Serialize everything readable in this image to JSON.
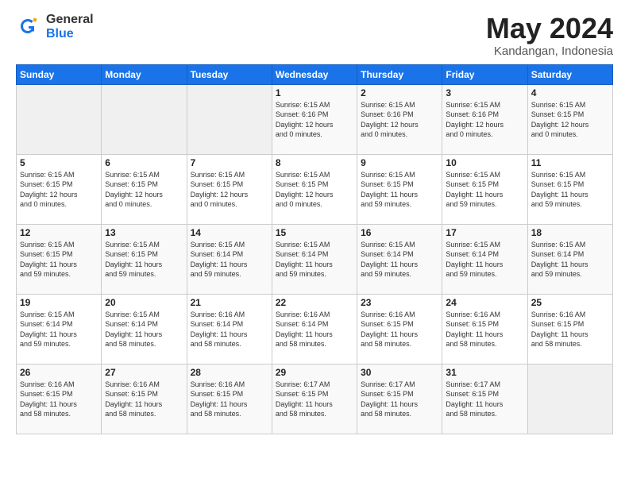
{
  "header": {
    "logo_general": "General",
    "logo_blue": "Blue",
    "title": "May 2024",
    "location": "Kandangan, Indonesia"
  },
  "weekdays": [
    "Sunday",
    "Monday",
    "Tuesday",
    "Wednesday",
    "Thursday",
    "Friday",
    "Saturday"
  ],
  "weeks": [
    [
      {
        "day": "",
        "info": ""
      },
      {
        "day": "",
        "info": ""
      },
      {
        "day": "",
        "info": ""
      },
      {
        "day": "1",
        "info": "Sunrise: 6:15 AM\nSunset: 6:16 PM\nDaylight: 12 hours\nand 0 minutes."
      },
      {
        "day": "2",
        "info": "Sunrise: 6:15 AM\nSunset: 6:16 PM\nDaylight: 12 hours\nand 0 minutes."
      },
      {
        "day": "3",
        "info": "Sunrise: 6:15 AM\nSunset: 6:16 PM\nDaylight: 12 hours\nand 0 minutes."
      },
      {
        "day": "4",
        "info": "Sunrise: 6:15 AM\nSunset: 6:15 PM\nDaylight: 12 hours\nand 0 minutes."
      }
    ],
    [
      {
        "day": "5",
        "info": "Sunrise: 6:15 AM\nSunset: 6:15 PM\nDaylight: 12 hours\nand 0 minutes."
      },
      {
        "day": "6",
        "info": "Sunrise: 6:15 AM\nSunset: 6:15 PM\nDaylight: 12 hours\nand 0 minutes."
      },
      {
        "day": "7",
        "info": "Sunrise: 6:15 AM\nSunset: 6:15 PM\nDaylight: 12 hours\nand 0 minutes."
      },
      {
        "day": "8",
        "info": "Sunrise: 6:15 AM\nSunset: 6:15 PM\nDaylight: 12 hours\nand 0 minutes."
      },
      {
        "day": "9",
        "info": "Sunrise: 6:15 AM\nSunset: 6:15 PM\nDaylight: 11 hours\nand 59 minutes."
      },
      {
        "day": "10",
        "info": "Sunrise: 6:15 AM\nSunset: 6:15 PM\nDaylight: 11 hours\nand 59 minutes."
      },
      {
        "day": "11",
        "info": "Sunrise: 6:15 AM\nSunset: 6:15 PM\nDaylight: 11 hours\nand 59 minutes."
      }
    ],
    [
      {
        "day": "12",
        "info": "Sunrise: 6:15 AM\nSunset: 6:15 PM\nDaylight: 11 hours\nand 59 minutes."
      },
      {
        "day": "13",
        "info": "Sunrise: 6:15 AM\nSunset: 6:15 PM\nDaylight: 11 hours\nand 59 minutes."
      },
      {
        "day": "14",
        "info": "Sunrise: 6:15 AM\nSunset: 6:14 PM\nDaylight: 11 hours\nand 59 minutes."
      },
      {
        "day": "15",
        "info": "Sunrise: 6:15 AM\nSunset: 6:14 PM\nDaylight: 11 hours\nand 59 minutes."
      },
      {
        "day": "16",
        "info": "Sunrise: 6:15 AM\nSunset: 6:14 PM\nDaylight: 11 hours\nand 59 minutes."
      },
      {
        "day": "17",
        "info": "Sunrise: 6:15 AM\nSunset: 6:14 PM\nDaylight: 11 hours\nand 59 minutes."
      },
      {
        "day": "18",
        "info": "Sunrise: 6:15 AM\nSunset: 6:14 PM\nDaylight: 11 hours\nand 59 minutes."
      }
    ],
    [
      {
        "day": "19",
        "info": "Sunrise: 6:15 AM\nSunset: 6:14 PM\nDaylight: 11 hours\nand 59 minutes."
      },
      {
        "day": "20",
        "info": "Sunrise: 6:15 AM\nSunset: 6:14 PM\nDaylight: 11 hours\nand 58 minutes."
      },
      {
        "day": "21",
        "info": "Sunrise: 6:16 AM\nSunset: 6:14 PM\nDaylight: 11 hours\nand 58 minutes."
      },
      {
        "day": "22",
        "info": "Sunrise: 6:16 AM\nSunset: 6:14 PM\nDaylight: 11 hours\nand 58 minutes."
      },
      {
        "day": "23",
        "info": "Sunrise: 6:16 AM\nSunset: 6:15 PM\nDaylight: 11 hours\nand 58 minutes."
      },
      {
        "day": "24",
        "info": "Sunrise: 6:16 AM\nSunset: 6:15 PM\nDaylight: 11 hours\nand 58 minutes."
      },
      {
        "day": "25",
        "info": "Sunrise: 6:16 AM\nSunset: 6:15 PM\nDaylight: 11 hours\nand 58 minutes."
      }
    ],
    [
      {
        "day": "26",
        "info": "Sunrise: 6:16 AM\nSunset: 6:15 PM\nDaylight: 11 hours\nand 58 minutes."
      },
      {
        "day": "27",
        "info": "Sunrise: 6:16 AM\nSunset: 6:15 PM\nDaylight: 11 hours\nand 58 minutes."
      },
      {
        "day": "28",
        "info": "Sunrise: 6:16 AM\nSunset: 6:15 PM\nDaylight: 11 hours\nand 58 minutes."
      },
      {
        "day": "29",
        "info": "Sunrise: 6:17 AM\nSunset: 6:15 PM\nDaylight: 11 hours\nand 58 minutes."
      },
      {
        "day": "30",
        "info": "Sunrise: 6:17 AM\nSunset: 6:15 PM\nDaylight: 11 hours\nand 58 minutes."
      },
      {
        "day": "31",
        "info": "Sunrise: 6:17 AM\nSunset: 6:15 PM\nDaylight: 11 hours\nand 58 minutes."
      },
      {
        "day": "",
        "info": ""
      }
    ]
  ]
}
